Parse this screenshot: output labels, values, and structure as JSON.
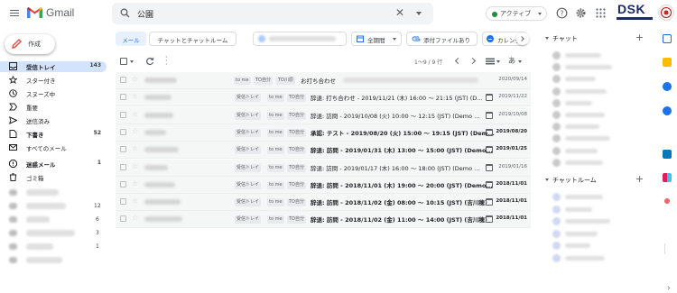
{
  "app": {
    "name": "Gmail"
  },
  "search": {
    "query": "公園"
  },
  "status": {
    "label": "アクティブ"
  },
  "brand": {
    "logo_text": "DSK"
  },
  "compose": {
    "label": "作成"
  },
  "nav": [
    {
      "label": "受信トレイ",
      "count": "143",
      "bold": true,
      "icon": "inbox-icon"
    },
    {
      "label": "スター付き",
      "count": "",
      "bold": false,
      "icon": "star-icon"
    },
    {
      "label": "スヌーズ中",
      "count": "",
      "bold": false,
      "icon": "clock-icon"
    },
    {
      "label": "重要",
      "count": "",
      "bold": false,
      "icon": "important-icon"
    },
    {
      "label": "送信済み",
      "count": "",
      "bold": false,
      "icon": "send-icon"
    },
    {
      "label": "下書き",
      "count": "52",
      "bold": true,
      "icon": "draft-icon"
    },
    {
      "label": "すべてのメール",
      "count": "",
      "bold": false,
      "icon": "all-mail-icon"
    },
    {
      "label": "迷惑メール",
      "count": "1",
      "bold": true,
      "icon": "spam-icon"
    },
    {
      "label": "ゴミ箱",
      "count": "",
      "bold": false,
      "icon": "trash-icon"
    }
  ],
  "nav_labels_counts": [
    {
      "count": "12"
    },
    {
      "count": "6"
    },
    {
      "count": "3"
    },
    {
      "count": "1"
    }
  ],
  "filters": {
    "tab_mail": "メール",
    "tab_chat": "チャットとチャットルーム",
    "period": "全期間",
    "attachment": "添付ファイルあり",
    "calendar": "カレンダーの通"
  },
  "pagination": {
    "text": "1～9 / 9 行"
  },
  "sort": {
    "label": "あ"
  },
  "rows": [
    {
      "tags": [
        "to me",
        "TO自分",
        "TO川原"
      ],
      "subject": "お打ち合わせ",
      "bold": false,
      "date": "2020/09/14",
      "has_cal": false
    },
    {
      "tags": [
        "受信トレイ",
        "to me",
        "TO自分"
      ],
      "subject": "辞退: 打ち合わせ - 2019/11/21 (木) 16:00 ～ 21:15 (JST) (D...",
      "bold": false,
      "date": "2019/11/22",
      "has_cal": true
    },
    {
      "tags": [
        "受信トレイ",
        "to me",
        "TO自分"
      ],
      "subject": "辞退: 訪問 - 2019/10/08 (火) 10:00 ～ 12:15 (JST) (Demo ...",
      "bold": false,
      "date": "2019/10/08",
      "has_cal": true
    },
    {
      "tags": [
        "受信トレイ",
        "to me",
        "TO自分"
      ],
      "subject": "承認: テスト - 2019/08/20 (火) 15:00 ～ 19:15 (JST) (Dem...",
      "bold": true,
      "date": "2019/08/20",
      "has_cal": true
    },
    {
      "tags": [
        "受信トレイ",
        "to me",
        "TO自分"
      ],
      "subject": "辞退: 訪問 - 2019/01/31 (木) 13:00 ～ 15:00 (JST) (Demo...",
      "bold": true,
      "date": "2019/01/25",
      "has_cal": true
    },
    {
      "tags": [
        "受信トレイ",
        "to me",
        "TO自分"
      ],
      "subject": "辞退: 訪問 - 2019/01/17 (木) 16:00 ～ 18:00 (JST) (Demo ...",
      "bold": false,
      "date": "2019/01/16",
      "has_cal": true
    },
    {
      "tags": [
        "受信トレイ",
        "to me",
        "TO自分"
      ],
      "subject": "辞退: 訪問 - 2018/11/01 (木) 19:00 ～ 20:00 (JST) (Demo...",
      "bold": true,
      "date": "2018/11/01",
      "has_cal": true
    },
    {
      "tags": [
        "受信トレイ",
        "to me",
        "TO自分"
      ],
      "subject": "辞退: 訪問 - 2018/11/02 (金) 08:00 ～ 10:15 (JST) (吉川穂)",
      "bold": true,
      "date": "2018/11/01",
      "has_cal": true
    },
    {
      "tags": [
        "受信トレイ",
        "to me",
        "TO自分"
      ],
      "subject": "辞退: 訪問 - 2018/11/02 (金) 11:00 ～ 14:00 (JST) (吉川穂)",
      "bold": true,
      "date": "2018/11/01",
      "has_cal": true
    }
  ],
  "chat": {
    "title": "チャット",
    "rooms_title": "チャットルーム"
  },
  "colors": {
    "accent": "#1a73e8",
    "compose_red": "#ea4335",
    "brand_navy": "#1a2a6c"
  }
}
